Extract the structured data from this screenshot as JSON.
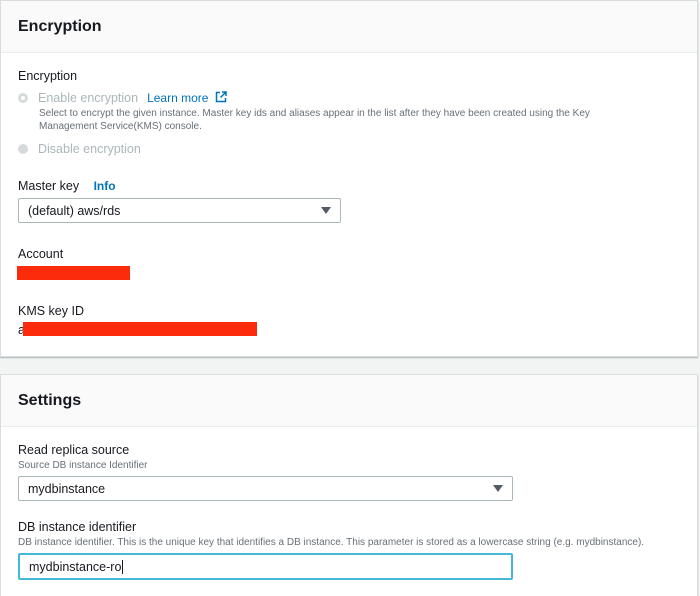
{
  "encryption": {
    "section_title": "Encryption",
    "field_label": "Encryption",
    "options": {
      "enable_label": "Enable encryption",
      "learn_more": "Learn more",
      "enable_description": "Select to encrypt the given instance. Master key ids and aliases appear in the list after they have been created using the Key Management Service(KMS) console.",
      "disable_label": "Disable encryption",
      "selected": "Enable encryption"
    },
    "master_key": {
      "label": "Master key",
      "info": "Info",
      "value": "(default) aws/rds"
    },
    "account": {
      "label": "Account"
    },
    "kms_key": {
      "label": "KMS key ID",
      "visible_prefix": "a"
    }
  },
  "settings": {
    "section_title": "Settings",
    "read_replica": {
      "label": "Read replica source",
      "description": "Source DB instance Identifier",
      "value": "mydbinstance"
    },
    "db_identifier": {
      "label": "DB instance identifier",
      "description": "DB instance identifier. This is the unique key that identifies a DB instance. This parameter is stored as a lowercase string (e.g. mydbinstance).",
      "value": "mydbinstance-ro"
    }
  },
  "colors": {
    "link": "#0073bb",
    "redaction": "#fc2b0b",
    "focus_border": "#44b9d6"
  },
  "icons": [
    "external-link-icon",
    "caret-down-icon"
  ]
}
